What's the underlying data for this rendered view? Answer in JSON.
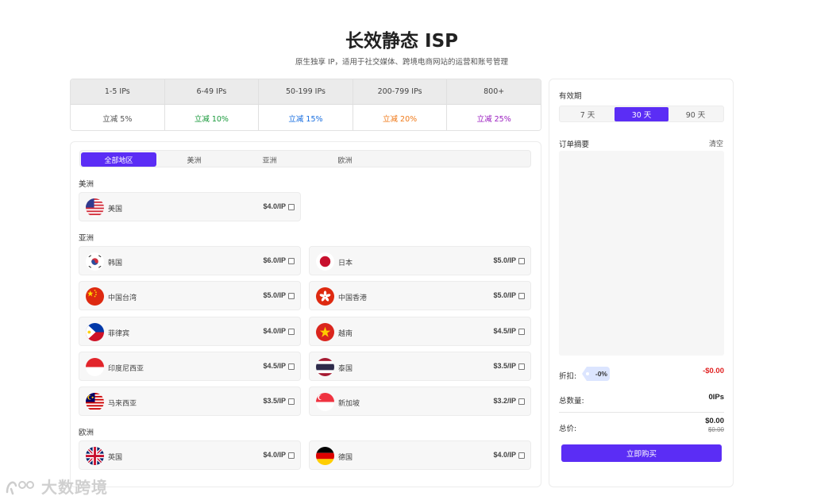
{
  "header": {
    "title": "长效静态 ISP",
    "subtitle": "原生独享 IP，适用于社交媒体、跨境电商网站的运营和账号管理"
  },
  "tiers": [
    {
      "range": "1-5 IPs",
      "discount": "立减 5%",
      "color": "#555555"
    },
    {
      "range": "6-49 IPs",
      "discount": "立减 10%",
      "color": "#1a9a3c"
    },
    {
      "range": "50-199 IPs",
      "discount": "立减 15%",
      "color": "#1a6fe0"
    },
    {
      "range": "200-799 IPs",
      "discount": "立减 20%",
      "color": "#f07a1a"
    },
    {
      "range": "800+",
      "discount": "立减 25%",
      "color": "#9b1fc0"
    }
  ],
  "region_tabs": [
    "全部地区",
    "美洲",
    "亚洲",
    "欧洲"
  ],
  "groups": {
    "americas": "美洲",
    "asia": "亚洲",
    "europe": "欧洲"
  },
  "countries": {
    "us": {
      "name": "美国",
      "price": "$4.0/IP",
      "flag": "us-flag"
    },
    "kr": {
      "name": "韩国",
      "price": "$6.0/IP",
      "flag": "kr-flag"
    },
    "jp": {
      "name": "日本",
      "price": "$5.0/IP",
      "flag": "jp-flag"
    },
    "tw": {
      "name": "中国台湾",
      "price": "$5.0/IP",
      "flag": "tw-flag"
    },
    "hk": {
      "name": "中国香港",
      "price": "$5.0/IP",
      "flag": "hk-flag"
    },
    "ph": {
      "name": "菲律宾",
      "price": "$4.0/IP",
      "flag": "ph-flag"
    },
    "vn": {
      "name": "越南",
      "price": "$4.5/IP",
      "flag": "vn-flag"
    },
    "id": {
      "name": "印度尼西亚",
      "price": "$4.5/IP",
      "flag": "id-flag"
    },
    "th": {
      "name": "泰国",
      "price": "$3.5/IP",
      "flag": "th-flag"
    },
    "my": {
      "name": "马来西亚",
      "price": "$3.5/IP",
      "flag": "my-flag"
    },
    "sg": {
      "name": "新加坡",
      "price": "$3.2/IP",
      "flag": "sg-flag"
    },
    "gb": {
      "name": "英国",
      "price": "$4.0/IP",
      "flag": "gb-flag"
    },
    "de": {
      "name": "德国",
      "price": "$4.0/IP",
      "flag": "de-flag"
    }
  },
  "sidebar": {
    "validity_label": "有效期",
    "periods": [
      "7 天",
      "30 天",
      "90 天"
    ],
    "order_summary_label": "订单摘要",
    "clear_label": "清空",
    "discount_label": "折扣:",
    "discount_tag": "-0%",
    "discount_value": "-$0.00",
    "quantity_label": "总数量:",
    "quantity_value": "0IPs",
    "total_label": "总价:",
    "total_value": "$0.00",
    "original_value": "$0.00",
    "buy_label": "立即购买"
  },
  "watermark": "大数跨境"
}
